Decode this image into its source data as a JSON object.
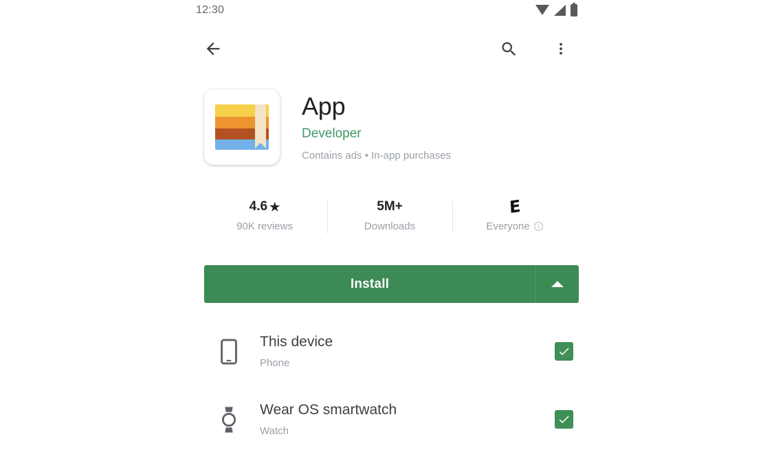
{
  "status_bar": {
    "time": "12:30",
    "icons": [
      "wifi-icon",
      "signal-icon",
      "battery-icon"
    ]
  },
  "toolbar": {
    "back_icon": "back-arrow-icon",
    "search_icon": "search-icon",
    "overflow_icon": "more-vert-icon"
  },
  "app": {
    "icon_name": "app-icon",
    "title": "App",
    "developer": "Developer",
    "tags": "Contains ads  •  In-app purchases"
  },
  "stats": [
    {
      "value": "4.6",
      "star": "★",
      "label": "90K reviews",
      "kind": "rating"
    },
    {
      "value": "5M+",
      "label": "Downloads",
      "kind": "downloads"
    },
    {
      "value": "E",
      "label": "Everyone",
      "info_icon": "info-icon",
      "kind": "content-rating"
    }
  ],
  "install": {
    "label": "Install",
    "expand_icon": "caret-up-icon"
  },
  "devices": [
    {
      "icon": "phone-icon",
      "name": "This device",
      "type": "Phone",
      "checked": true
    },
    {
      "icon": "watch-icon",
      "name": "Wear OS smartwatch",
      "type": "Watch",
      "checked": true
    }
  ],
  "colors": {
    "install_green": "#3c8a54",
    "developer_green": "#3f9764",
    "checkbox_green": "#3f8f56",
    "text_primary": "#202124",
    "text_secondary": "#9aa0a6"
  }
}
